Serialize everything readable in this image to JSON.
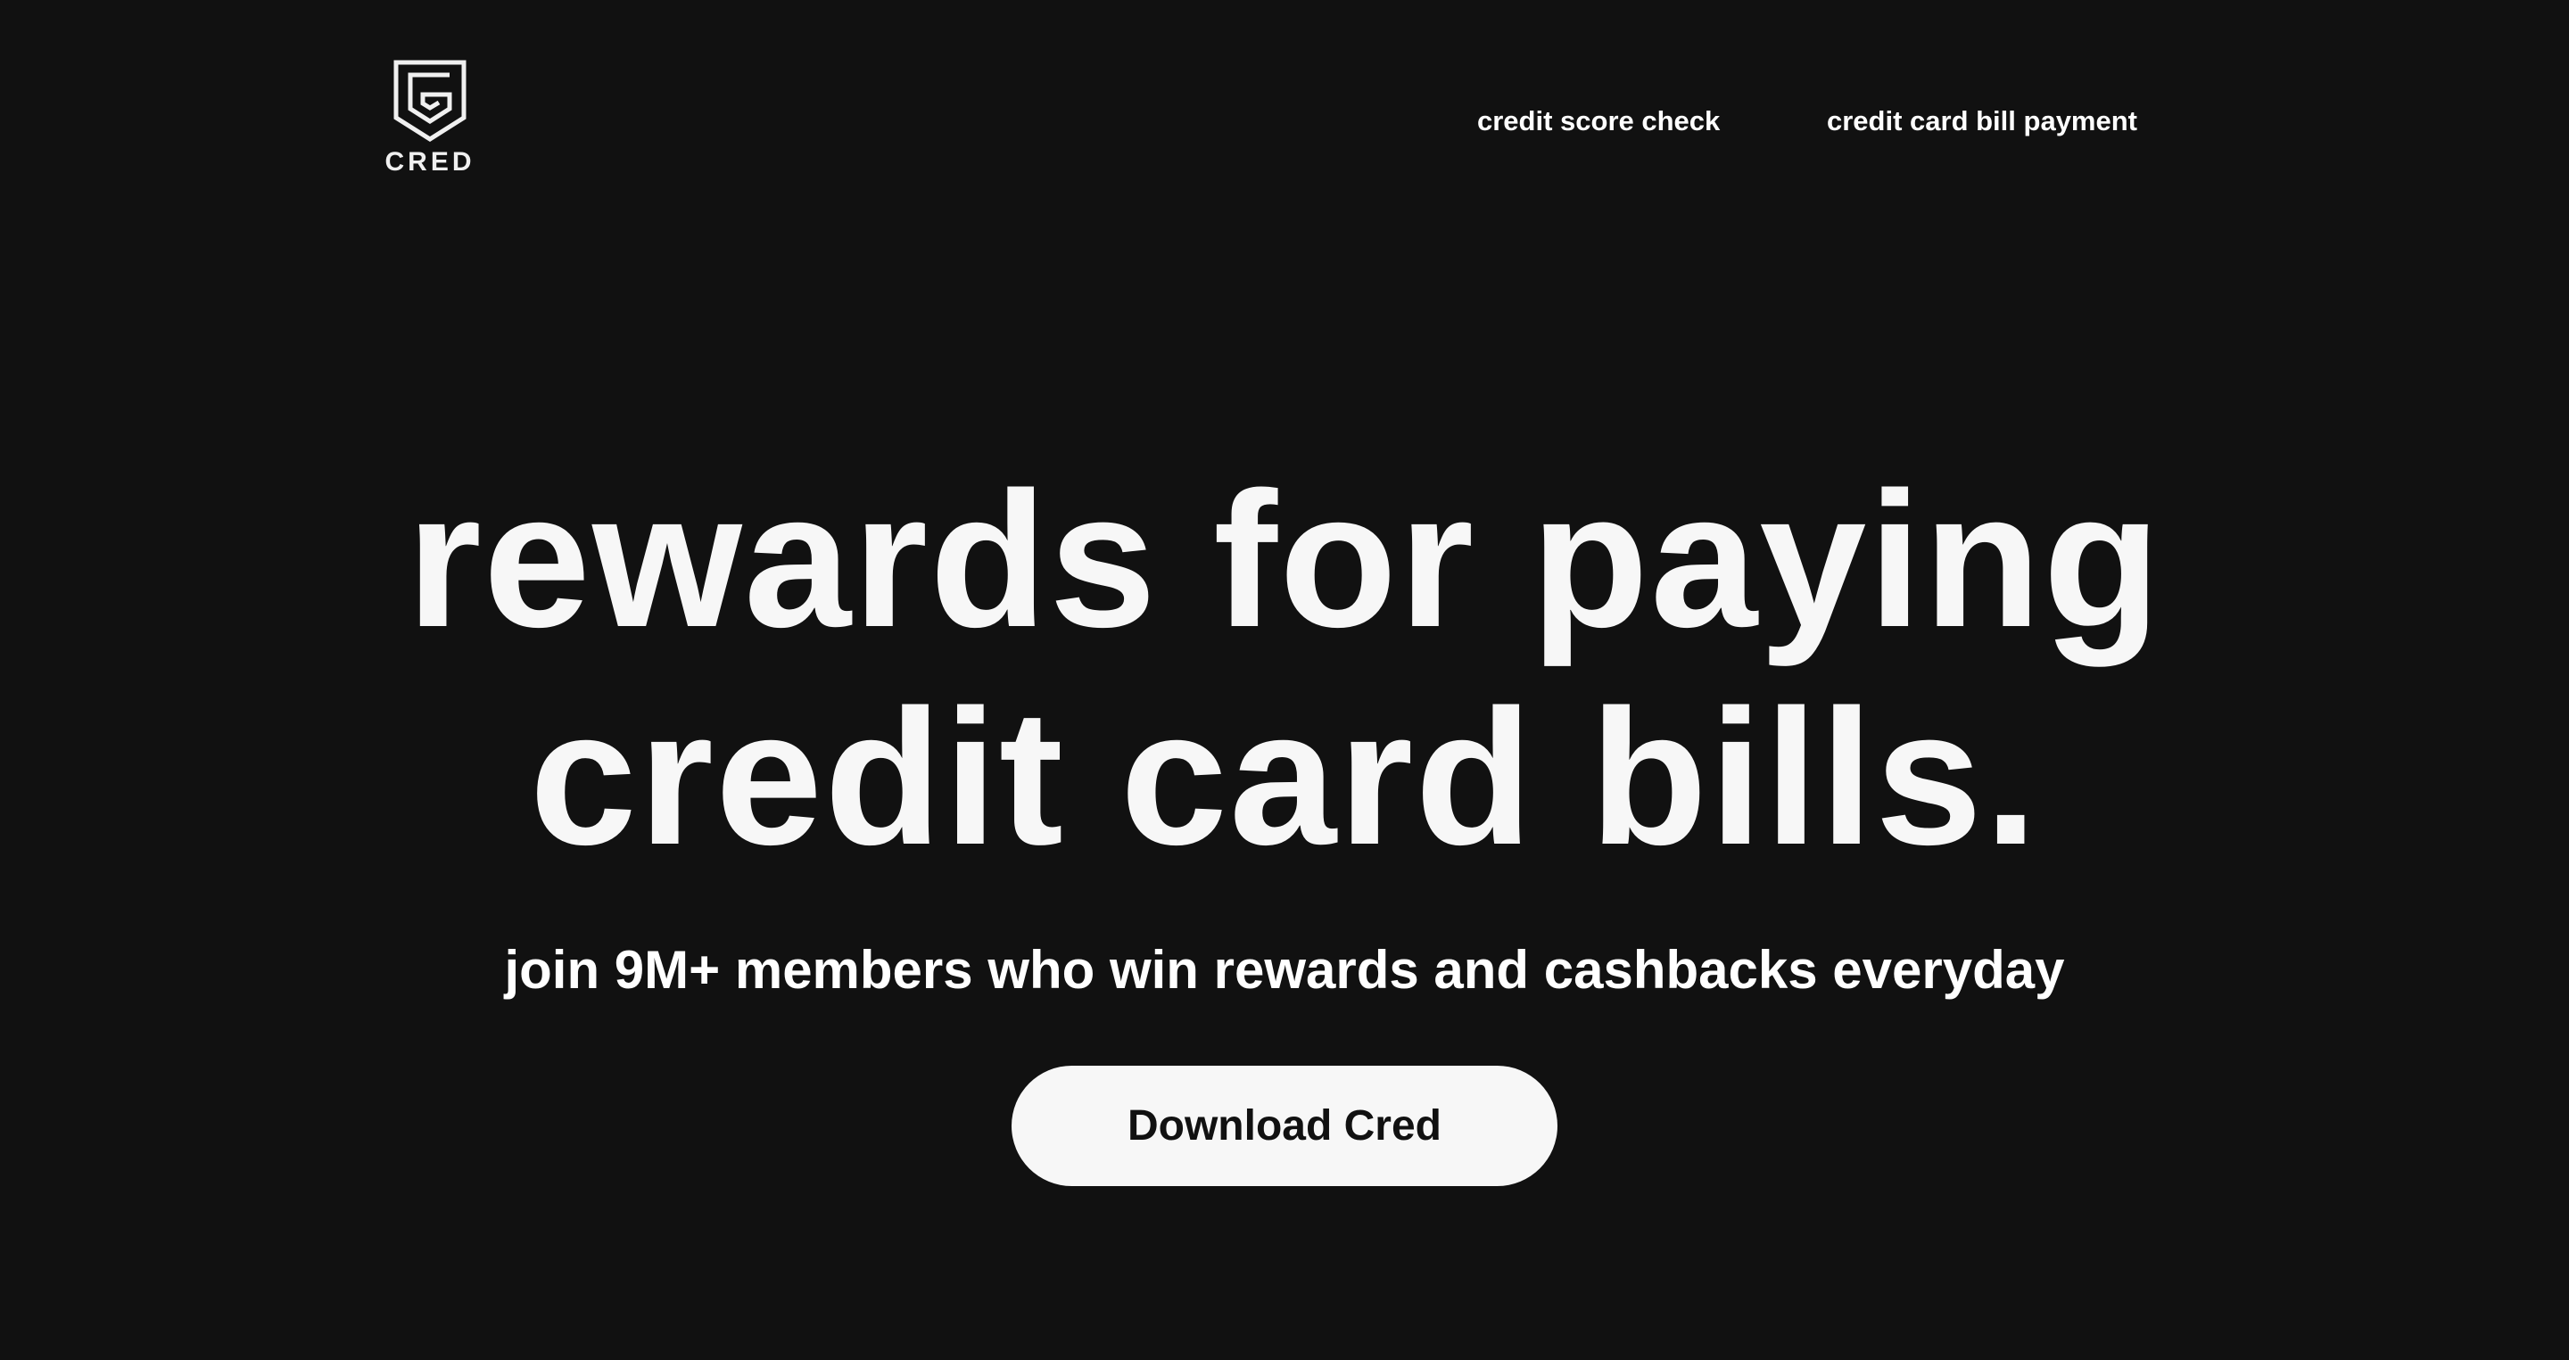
{
  "header": {
    "logo_text": "CRED",
    "nav": [
      {
        "label": "credit score check"
      },
      {
        "label": "credit card bill payment"
      }
    ]
  },
  "hero": {
    "title_line_1": "rewards for paying",
    "title_line_2": "credit card bills.",
    "subtitle": "join 9M+ members who win rewards and cashbacks everyday",
    "cta_label": "Download Cred"
  },
  "colors": {
    "background": "#111111",
    "text": "#f7f7f7",
    "button_bg": "#f7f7f7",
    "button_text": "#111111"
  }
}
